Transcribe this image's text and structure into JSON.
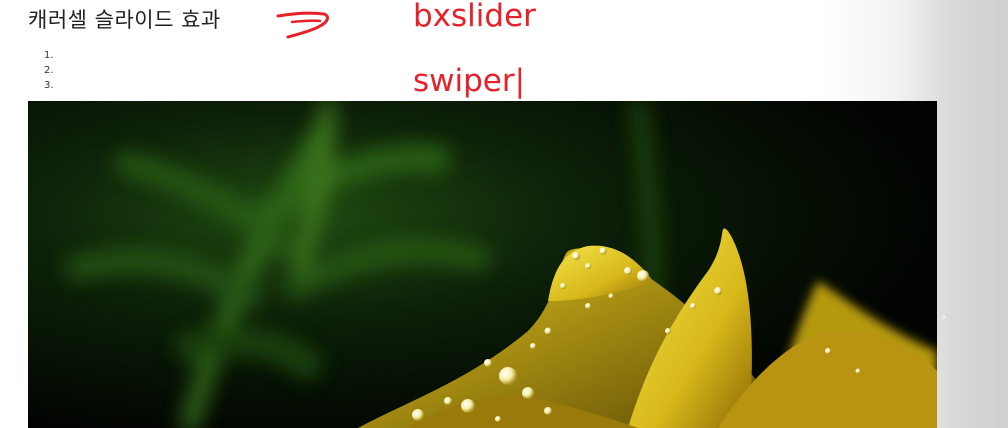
{
  "header": {
    "title": "캐러셀 슬라이드 효과"
  },
  "pager": {
    "items": [
      "1.",
      "2.",
      "3."
    ]
  },
  "annotations": {
    "arrow_icon": "hand-drawn-arrow-icon",
    "label_1": "bxslider",
    "label_2": "swiper|",
    "color": "#e8202a"
  },
  "slider": {
    "image": "yellow flower with water droplets on dark green background",
    "next_label": "›"
  }
}
